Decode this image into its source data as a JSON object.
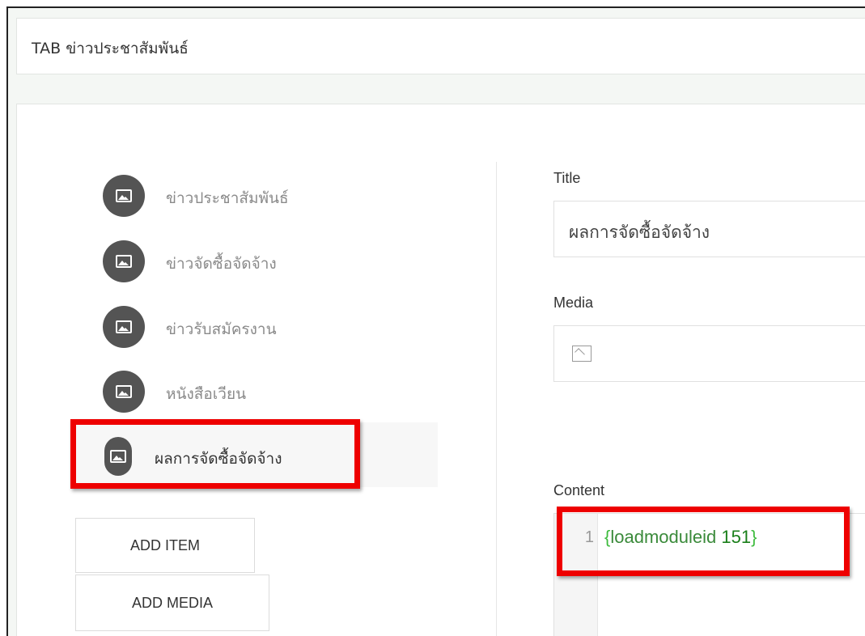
{
  "tab": {
    "title": "TAB ข่าวประชาสัมพันธ์"
  },
  "items": [
    {
      "label": "ข่าวประชาสัมพันธ์",
      "icon": "image-icon"
    },
    {
      "label": "ข่าวจัดซื้อจัดจ้าง",
      "icon": "image-icon"
    },
    {
      "label": "ข่าวรับสมัครงาน",
      "icon": "image-icon"
    },
    {
      "label": "หนังสือเวียน",
      "icon": "image-icon"
    },
    {
      "label": "ผลการจัดซื้อจัดจ้าง",
      "icon": "image-icon",
      "active": true
    }
  ],
  "buttons": {
    "add_item": "ADD ITEM",
    "add_media": "ADD MEDIA"
  },
  "form": {
    "title_label": "Title",
    "title_value": "ผลการจัดซื้อจัดจ้าง",
    "media_label": "Media",
    "media_icon": "image-placeholder-icon",
    "content_label": "Content"
  },
  "editor": {
    "line_number": "1",
    "open_brace": "{",
    "keyword": "loadmoduleid",
    "value": "151",
    "close_brace": "}"
  },
  "colors": {
    "highlight": "#ee0000",
    "code_green": "#3dbb3d",
    "icon_circle": "#545454"
  }
}
